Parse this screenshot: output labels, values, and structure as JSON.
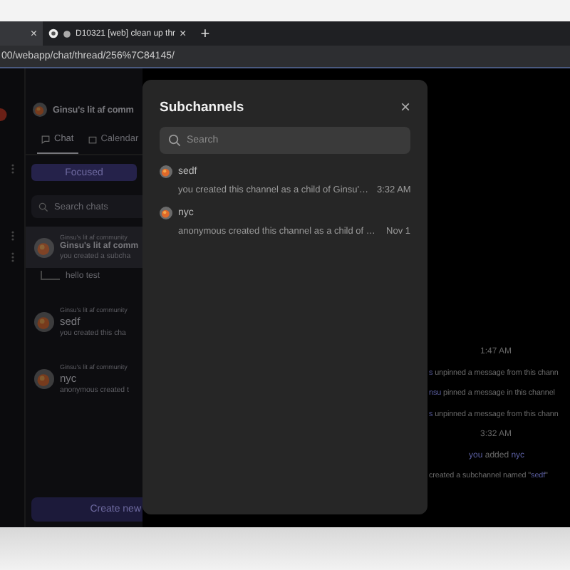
{
  "browser": {
    "tabs": [
      {
        "close": "×",
        "selected": true
      },
      {
        "title": "D10321 [web] clean up thr",
        "close": "×",
        "selected": false
      }
    ],
    "new_tab": "+",
    "url": "00/webapp/chat/thread/256%7C84145/"
  },
  "chat_panel": {
    "title": "Ginsu's lit af comm",
    "tabs": [
      {
        "label": "Chat",
        "selected": true
      },
      {
        "label": "Calendar",
        "selected": false
      }
    ],
    "filter_button": "Focused",
    "search": {
      "placeholder": "Search chats"
    },
    "chats": [
      {
        "community": "Ginsu's lit af community",
        "name": "Ginsu's lit af comm",
        "preview": "you created a subcha",
        "selected": true,
        "threads": [
          "hello test"
        ]
      },
      {
        "community": "Ginsu's lit af community",
        "name": "sedf",
        "preview": "you created this cha",
        "selected": false
      },
      {
        "community": "Ginsu's lit af community",
        "name": "nyc",
        "preview": "anonymous created t",
        "selected": false
      }
    ],
    "create_button": "Create new"
  },
  "events": [
    {
      "kind": "time",
      "text": "1:47 AM"
    },
    {
      "kind": "line",
      "parts": [
        {
          "link": true,
          "text": "s"
        },
        {
          "link": false,
          "text": " unpinned a message from this chann"
        }
      ]
    },
    {
      "kind": "line",
      "parts": [
        {
          "link": true,
          "text": "nsu"
        },
        {
          "link": false,
          "text": " pinned a message in this channel"
        }
      ]
    },
    {
      "kind": "line",
      "parts": [
        {
          "link": true,
          "text": "s"
        },
        {
          "link": false,
          "text": " unpinned a message from this chann"
        }
      ]
    },
    {
      "kind": "time",
      "text": "3:32 AM"
    },
    {
      "kind": "center",
      "parts": [
        {
          "link": true,
          "text": "you"
        },
        {
          "link": false,
          "text": " added "
        },
        {
          "link": true,
          "text": "nyc"
        }
      ]
    },
    {
      "kind": "line",
      "parts": [
        {
          "link": false,
          "text": "created a subchannel named \""
        },
        {
          "link": true,
          "text": "sedf"
        },
        {
          "link": false,
          "text": "\""
        }
      ]
    }
  ],
  "modal": {
    "title": "Subchannels",
    "close": "×",
    "search": {
      "placeholder": "Search"
    },
    "items": [
      {
        "name": "sedf",
        "description": "you created this channel as a child of Ginsu'…",
        "time": "3:32 AM"
      },
      {
        "name": "nyc",
        "description": "anonymous created this channel as a child of …",
        "time": "Nov 1"
      }
    ]
  }
}
